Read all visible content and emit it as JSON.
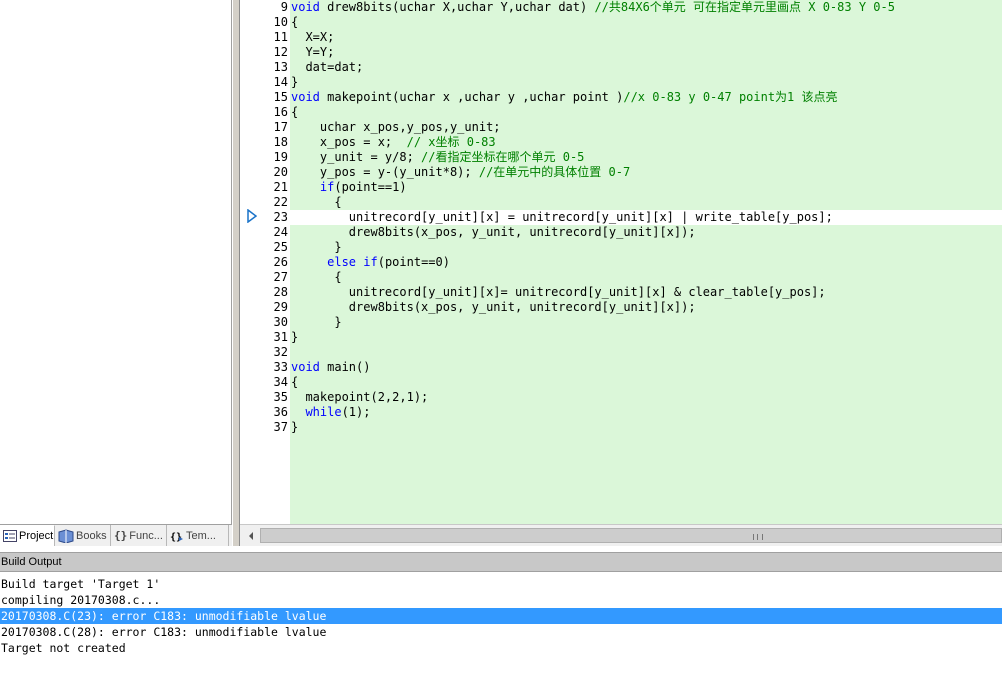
{
  "project_panel": {
    "tabs": [
      {
        "label": "Project",
        "icon": "project-icon"
      },
      {
        "label": "Books",
        "icon": "books-icon"
      },
      {
        "label": "Func...",
        "icon": "braces-icon"
      },
      {
        "label": "Tem...",
        "icon": "template-icon"
      }
    ]
  },
  "editor": {
    "current_line": 23,
    "lines": [
      {
        "n": "9",
        "text": "void drew8bits(uchar X,uchar Y,uchar dat) //共84X6个单元 可在指定单元里画点 X 0-83 Y 0-5"
      },
      {
        "n": "10",
        "text": "{"
      },
      {
        "n": "11",
        "text": "  X=X;"
      },
      {
        "n": "12",
        "text": "  Y=Y;"
      },
      {
        "n": "13",
        "text": "  dat=dat;"
      },
      {
        "n": "14",
        "text": "}"
      },
      {
        "n": "15",
        "text": "void makepoint(uchar x ,uchar y ,uchar point )//x 0-83 y 0-47 point为1 该点亮"
      },
      {
        "n": "16",
        "text": "{"
      },
      {
        "n": "17",
        "text": "    uchar x_pos,y_pos,y_unit;"
      },
      {
        "n": "18",
        "text": "    x_pos = x;  // x坐标 0-83"
      },
      {
        "n": "19",
        "text": "    y_unit = y/8; //看指定坐标在哪个单元 0-5"
      },
      {
        "n": "20",
        "text": "    y_pos = y-(y_unit*8); //在单元中的具体位置 0-7"
      },
      {
        "n": "21",
        "text": "    if(point==1)"
      },
      {
        "n": "22",
        "text": "      {"
      },
      {
        "n": "23",
        "text": "        unitrecord[y_unit][x] = unitrecord[y_unit][x] | write_table[y_pos];"
      },
      {
        "n": "24",
        "text": "        drew8bits(x_pos, y_unit, unitrecord[y_unit][x]);"
      },
      {
        "n": "25",
        "text": "      }"
      },
      {
        "n": "26",
        "text": "     else if(point==0)"
      },
      {
        "n": "27",
        "text": "      {"
      },
      {
        "n": "28",
        "text": "        unitrecord[y_unit][x]= unitrecord[y_unit][x] & clear_table[y_pos];"
      },
      {
        "n": "29",
        "text": "        drew8bits(x_pos, y_unit, unitrecord[y_unit][x]);"
      },
      {
        "n": "30",
        "text": "      }"
      },
      {
        "n": "31",
        "text": "}"
      },
      {
        "n": "32",
        "text": ""
      },
      {
        "n": "33",
        "text": "void main()"
      },
      {
        "n": "34",
        "text": "{"
      },
      {
        "n": "35",
        "text": "  makepoint(2,2,1);"
      },
      {
        "n": "36",
        "text": "  while(1);"
      },
      {
        "n": "37",
        "text": "}"
      }
    ]
  },
  "build_output": {
    "title": "Build Output",
    "lines": [
      {
        "text": "Build target 'Target 1'",
        "selected": false
      },
      {
        "text": "compiling 20170308.c...",
        "selected": false
      },
      {
        "text": "20170308.C(23): error C183: unmodifiable lvalue",
        "selected": true
      },
      {
        "text": "20170308.C(28): error C183: unmodifiable lvalue",
        "selected": false
      },
      {
        "text": "Target not created",
        "selected": false
      }
    ]
  },
  "colors": {
    "editor_bg": "#dbf7d9",
    "keyword": "#0000ff",
    "comment": "#008000",
    "selection": "#3399ff"
  }
}
